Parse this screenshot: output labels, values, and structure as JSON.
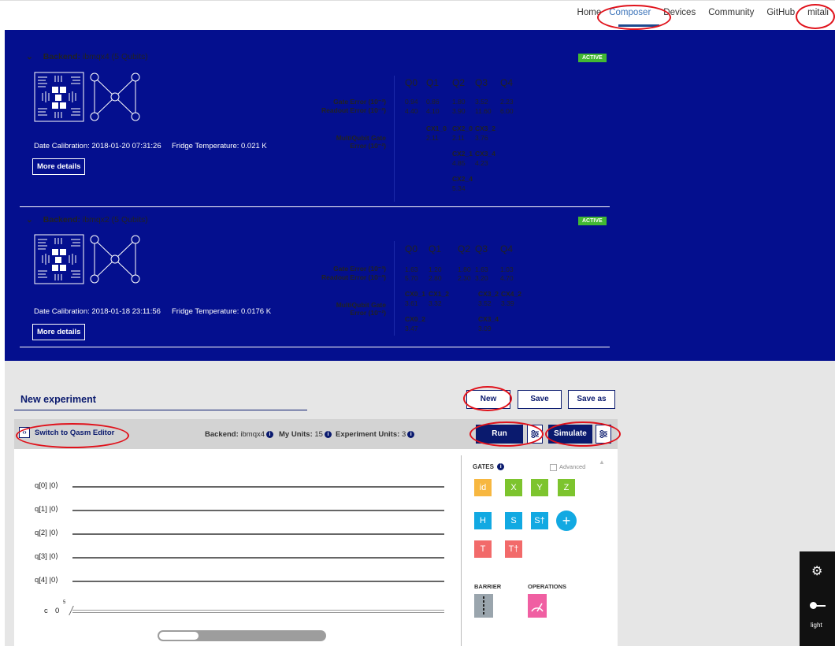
{
  "nav": {
    "items": [
      "Home",
      "Composer",
      "Devices",
      "Community",
      "GitHub",
      "mitali"
    ],
    "active": "Composer"
  },
  "backends": [
    {
      "label": "Backend:",
      "name": "ibmqx4 (5 Qubits)",
      "status": "ACTIVE",
      "calibration": "Date Calibration: 2018-01-20 07:31:26",
      "fridge": "Fridge Temperature: 0.021 K",
      "more": "More details",
      "qubits": [
        "Q0",
        "Q1",
        "Q2",
        "Q3",
        "Q4"
      ],
      "gate_error_label": "Gate Error (10⁻³)",
      "readout_error_label": "Readout Error (10⁻²)",
      "multi_label_1": "MultiQubit Gate",
      "multi_label_2": "Error (10⁻²)",
      "gate_error": [
        "0.94",
        "0.86",
        "1.80",
        "3.52",
        "2.23"
      ],
      "readout_error": [
        "4.40",
        "4.10",
        "3.90",
        "11.60",
        "6.00"
      ],
      "cx": [
        {
          "name": "CX1_0",
          "value": "2.11"
        },
        {
          "name": "CX2_0",
          "value": "2.11"
        },
        {
          "name": "CX3_2",
          "value": "3.76"
        },
        {
          "name": "CX2_1",
          "value": "4.85"
        },
        {
          "name": "CX3_4",
          "value": "4.23"
        },
        {
          "name": "CX2_4",
          "value": "5.34"
        }
      ]
    },
    {
      "label": "Backend:",
      "name": "ibmqx2 (5 Qubits)",
      "status": "ACTIVE",
      "calibration": "Date Calibration: 2018-01-18 23:11:56",
      "fridge": "Fridge Temperature: 0.0176 K",
      "more": "More details",
      "qubits": [
        "Q0",
        "Q1",
        "Q2",
        "Q3",
        "Q4"
      ],
      "gate_error_label": "Gate Error (10⁻³)",
      "readout_error_label": "Readout Error (10⁻²)",
      "multi_label_1": "MultiQubit Gate",
      "multi_label_2": "Error (10⁻²)",
      "gate_error": [
        "1.63",
        "1.20",
        "1.80",
        "1.63",
        "1.03"
      ],
      "readout_error": [
        "5.70",
        "2.80",
        "2.30",
        "3.20",
        "4.70"
      ],
      "cx": [
        {
          "name": "CX0_1",
          "value": "3.61"
        },
        {
          "name": "CX1_2",
          "value": "3.32"
        },
        {
          "name": "CX3_2",
          "value": "3.52"
        },
        {
          "name": "CX4_2",
          "value": "3.39"
        },
        {
          "name": "CX0_2",
          "value": "3.47"
        },
        {
          "name": "CX3_4",
          "value": "3.09"
        }
      ]
    }
  ],
  "experiment": {
    "title": "New experiment",
    "new": "New",
    "save": "Save",
    "save_as": "Save as"
  },
  "toolbar": {
    "toggle": "‹›",
    "switch": "Switch to Qasm Editor",
    "backend_label": "Backend:",
    "backend_value": "ibmqx4",
    "units_label": "My Units:",
    "units_value": "15",
    "exp_units_label": "Experiment Units:",
    "exp_units_value": "3",
    "run": "Run",
    "simulate": "Simulate"
  },
  "circuit": {
    "qubits": [
      "q[0]",
      "q[1]",
      "q[2]",
      "q[3]",
      "q[4]"
    ],
    "ket": "|0⟩",
    "classical": "c",
    "classical_ket": "0",
    "classical_bits": "5"
  },
  "gates": {
    "title": "GATES",
    "advanced": "Advanced",
    "row1": [
      {
        "label": "id",
        "color": "#f7b740"
      },
      {
        "label": "X",
        "color": "#7dc42e"
      },
      {
        "label": "Y",
        "color": "#7dc42e"
      },
      {
        "label": "Z",
        "color": "#7dc42e"
      }
    ],
    "row2": [
      {
        "label": "H",
        "color": "#12a9e2"
      },
      {
        "label": "S",
        "color": "#12a9e2"
      },
      {
        "label": "S†",
        "color": "#12a9e2"
      }
    ],
    "row3": [
      {
        "label": "T",
        "color": "#f26a6a"
      },
      {
        "label": "T†",
        "color": "#f26a6a"
      }
    ],
    "barrier": "BARRIER",
    "operations": "OPERATIONS"
  },
  "sidebar": {
    "bug_icon": "bug-icon",
    "theme_label": "light"
  }
}
